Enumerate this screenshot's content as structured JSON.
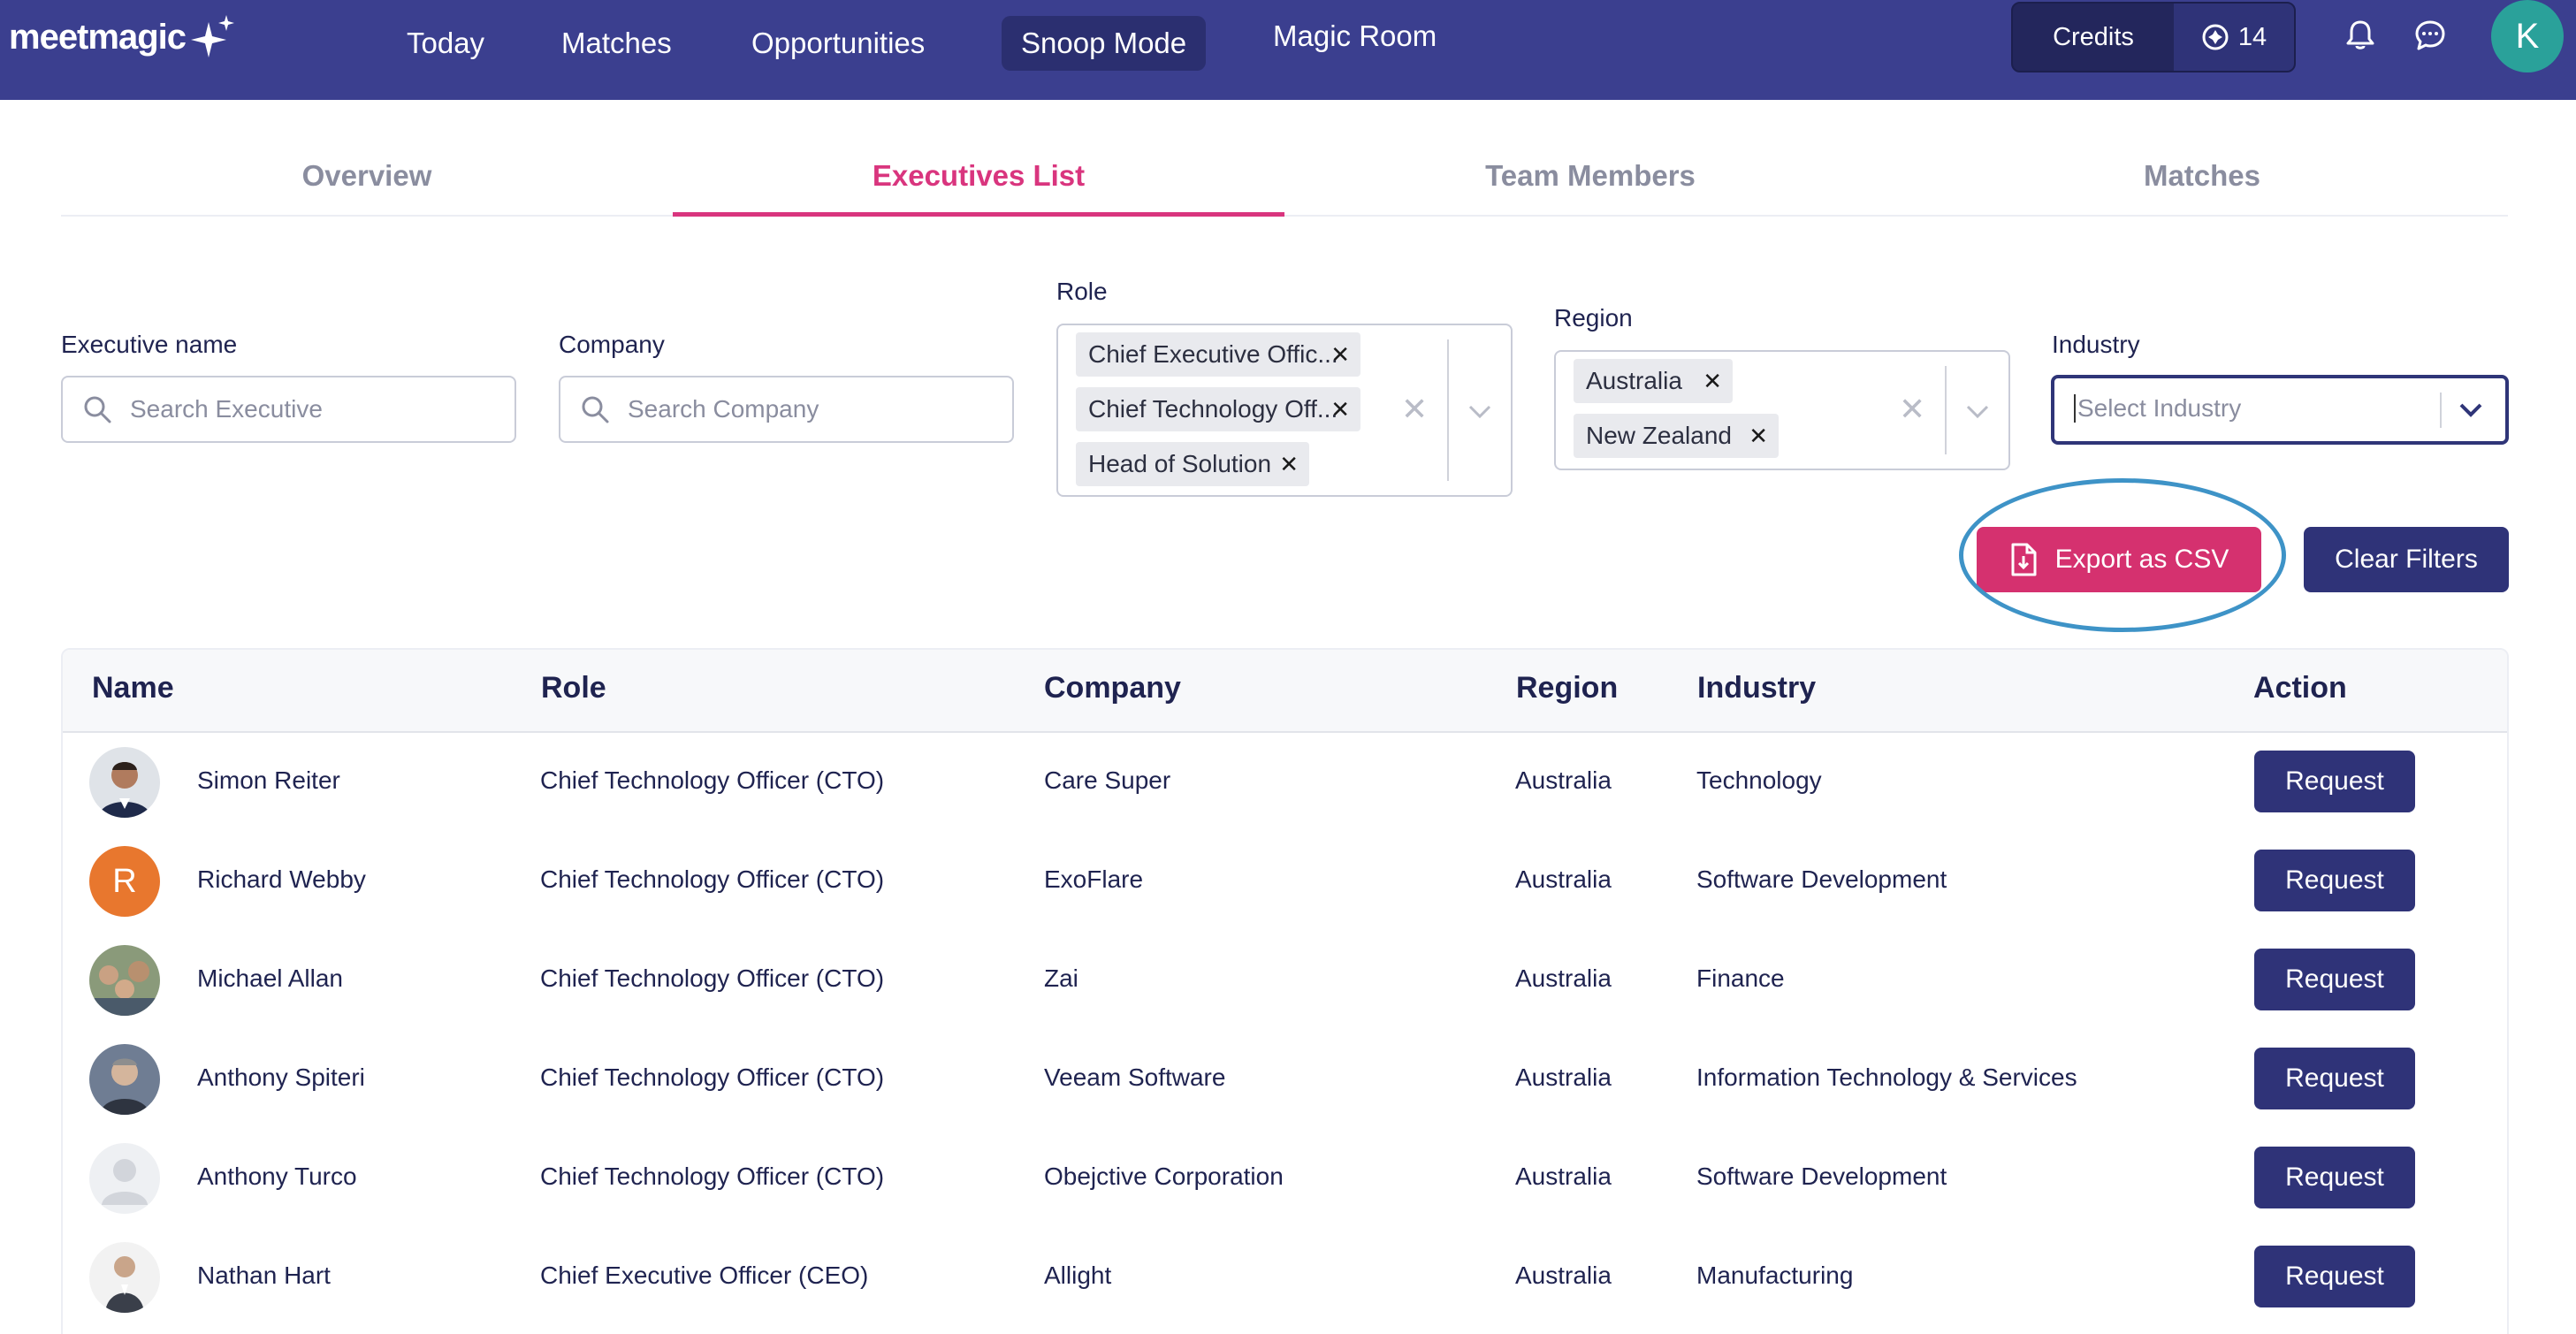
{
  "nav": {
    "logo": "meetmagic",
    "links": [
      "Today",
      "Matches",
      "Opportunities",
      "Snoop Mode",
      "Magic Room"
    ],
    "active_link": "Snoop Mode",
    "credits_label": "Credits",
    "credits_count": "14",
    "avatar_letter": "K"
  },
  "tabs": [
    "Overview",
    "Executives List",
    "Team Members",
    "Matches"
  ],
  "active_tab": "Executives List",
  "filters": {
    "executive": {
      "label": "Executive name",
      "placeholder": "Search Executive"
    },
    "company": {
      "label": "Company",
      "placeholder": "Search Company"
    },
    "role": {
      "label": "Role",
      "chips": [
        "Chief Executive Offic...",
        "Chief Technology Off...",
        "Head of Solution"
      ]
    },
    "region": {
      "label": "Region",
      "chips": [
        "Australia",
        "New Zealand"
      ]
    },
    "industry": {
      "label": "Industry",
      "placeholder": "Select Industry"
    }
  },
  "actions": {
    "export_label": "Export as CSV",
    "clear_label": "Clear Filters"
  },
  "table": {
    "headers": [
      "Name",
      "Role",
      "Company",
      "Region",
      "Industry",
      "Action"
    ],
    "rows": [
      {
        "name": "Simon Reiter",
        "role": "Chief Technology Officer (CTO)",
        "company": "Care Super",
        "region": "Australia",
        "industry": "Technology",
        "action": "Request"
      },
      {
        "name": "Richard Webby",
        "role": "Chief Technology Officer (CTO)",
        "company": "ExoFlare",
        "region": "Australia",
        "industry": "Software Development",
        "action": "Request",
        "initial": "R"
      },
      {
        "name": "Michael Allan",
        "role": "Chief Technology Officer (CTO)",
        "company": "Zai",
        "region": "Australia",
        "industry": "Finance",
        "action": "Request"
      },
      {
        "name": "Anthony Spiteri",
        "role": "Chief Technology Officer (CTO)",
        "company": "Veeam Software",
        "region": "Australia",
        "industry": "Information Technology & Services",
        "action": "Request"
      },
      {
        "name": "Anthony Turco",
        "role": "Chief Technology Officer (CTO)",
        "company": "Obejctive Corporation",
        "region": "Australia",
        "industry": "Software Development",
        "action": "Request"
      },
      {
        "name": "Nathan Hart",
        "role": "Chief Executive Officer (CEO)",
        "company": "Allight",
        "region": "Australia",
        "industry": "Manufacturing",
        "action": "Request"
      }
    ]
  },
  "colors": {
    "nav_bg": "#3b3f8f",
    "accent_pink": "#d9357e",
    "button_navy": "#2f3378",
    "highlight_ring": "#3e93c7"
  }
}
